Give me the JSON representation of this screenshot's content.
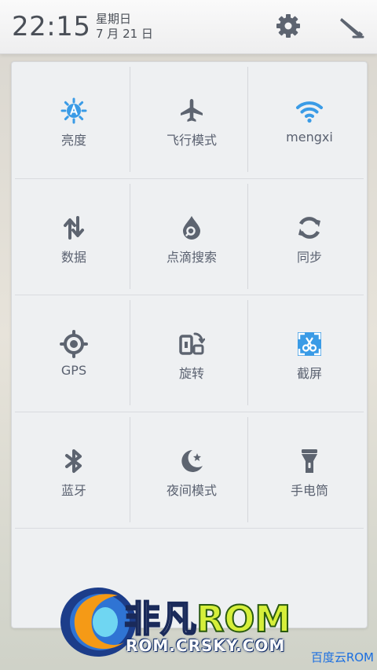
{
  "status": {
    "time": "22:15",
    "weekday": "星期日",
    "date": "7 月 21 日"
  },
  "colors": {
    "accent": "#3a9be6",
    "icon_gray": "#5d6470",
    "logo_blue": "#1c3d8a",
    "logo_green": "#d6ef3a"
  },
  "tiles": [
    {
      "label": "亮度",
      "icon": "brightness-auto-icon"
    },
    {
      "label": "飞行模式",
      "icon": "airplane-icon"
    },
    {
      "label": "mengxi",
      "icon": "wifi-icon"
    },
    {
      "label": "数据",
      "icon": "data-transfer-icon"
    },
    {
      "label": "点滴搜索",
      "icon": "drop-search-icon"
    },
    {
      "label": "同步",
      "icon": "sync-icon"
    },
    {
      "label": "GPS",
      "icon": "gps-icon"
    },
    {
      "label": "旋转",
      "icon": "rotate-icon"
    },
    {
      "label": "截屏",
      "icon": "screenshot-icon"
    },
    {
      "label": "蓝牙",
      "icon": "bluetooth-icon"
    },
    {
      "label": "夜间模式",
      "icon": "night-mode-icon"
    },
    {
      "label": "手电筒",
      "icon": "flashlight-icon"
    }
  ],
  "watermark": {
    "logo_cn": "非凡",
    "logo_rom": "ROM",
    "logo_url": "ROM.CRSKY.COM",
    "corner_text": "百度云ROM"
  }
}
